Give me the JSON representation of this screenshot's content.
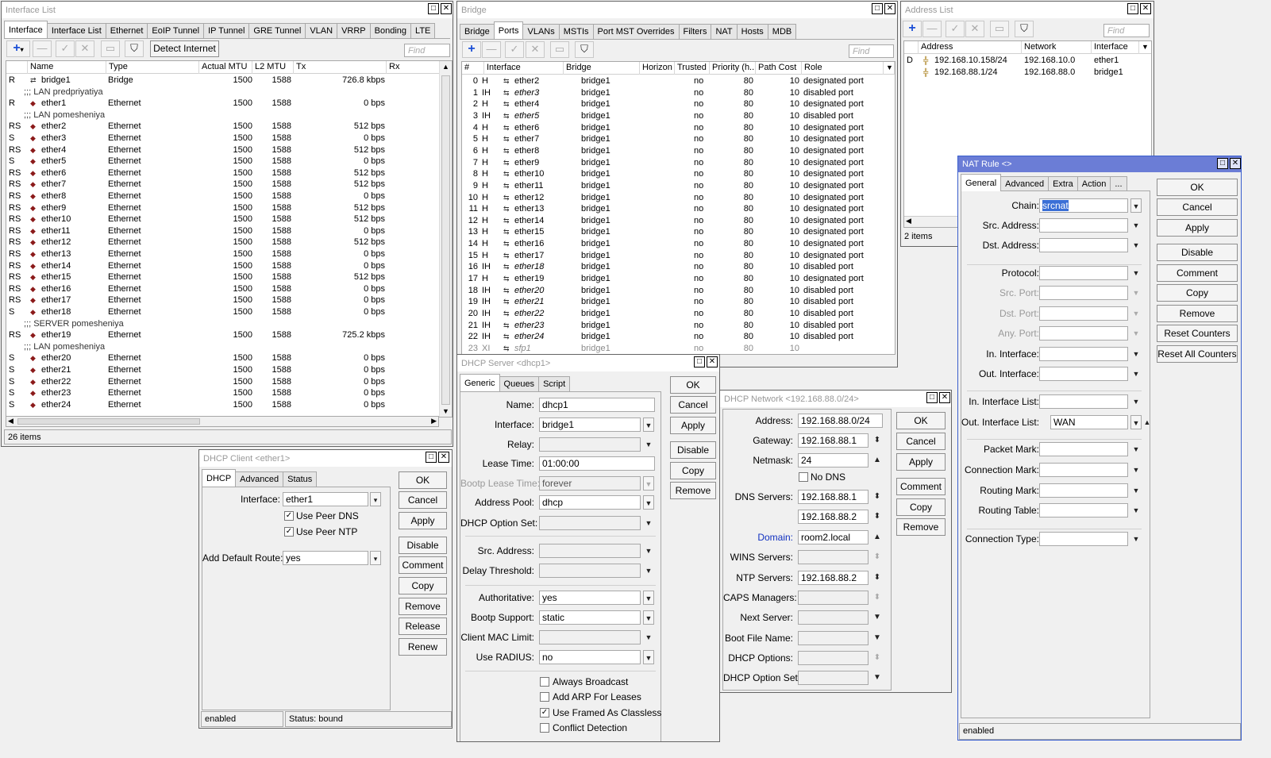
{
  "iface": {
    "title": "Interface List",
    "tabs": [
      "Interface",
      "Interface List",
      "Ethernet",
      "EoIP Tunnel",
      "IP Tunnel",
      "GRE Tunnel",
      "VLAN",
      "VRRP",
      "Bonding",
      "LTE"
    ],
    "detect_btn": "Detect Internet",
    "find": "Find",
    "cols": [
      "Name",
      "Type",
      "Actual MTU",
      "L2 MTU",
      "Tx",
      "Rx"
    ],
    "rows": [
      {
        "f": "R",
        "n": "bridge1",
        "t": "Bridge",
        "mtu": "1500",
        "l2": "1588",
        "tx": "726.8 kbps",
        "bridge": true
      },
      {
        "comment": ";;; LAN predpriyatiya"
      },
      {
        "f": "R",
        "n": "ether1",
        "t": "Ethernet",
        "mtu": "1500",
        "l2": "1588",
        "tx": "0 bps"
      },
      {
        "comment": ";;; LAN pomesheniya"
      },
      {
        "f": "RS",
        "n": "ether2",
        "t": "Ethernet",
        "mtu": "1500",
        "l2": "1588",
        "tx": "512 bps"
      },
      {
        "f": "S",
        "n": "ether3",
        "t": "Ethernet",
        "mtu": "1500",
        "l2": "1588",
        "tx": "0 bps"
      },
      {
        "f": "RS",
        "n": "ether4",
        "t": "Ethernet",
        "mtu": "1500",
        "l2": "1588",
        "tx": "512 bps"
      },
      {
        "f": "S",
        "n": "ether5",
        "t": "Ethernet",
        "mtu": "1500",
        "l2": "1588",
        "tx": "0 bps"
      },
      {
        "f": "RS",
        "n": "ether6",
        "t": "Ethernet",
        "mtu": "1500",
        "l2": "1588",
        "tx": "512 bps"
      },
      {
        "f": "RS",
        "n": "ether7",
        "t": "Ethernet",
        "mtu": "1500",
        "l2": "1588",
        "tx": "512 bps"
      },
      {
        "f": "RS",
        "n": "ether8",
        "t": "Ethernet",
        "mtu": "1500",
        "l2": "1588",
        "tx": "0 bps"
      },
      {
        "f": "RS",
        "n": "ether9",
        "t": "Ethernet",
        "mtu": "1500",
        "l2": "1588",
        "tx": "512 bps"
      },
      {
        "f": "RS",
        "n": "ether10",
        "t": "Ethernet",
        "mtu": "1500",
        "l2": "1588",
        "tx": "512 bps"
      },
      {
        "f": "RS",
        "n": "ether11",
        "t": "Ethernet",
        "mtu": "1500",
        "l2": "1588",
        "tx": "0 bps"
      },
      {
        "f": "RS",
        "n": "ether12",
        "t": "Ethernet",
        "mtu": "1500",
        "l2": "1588",
        "tx": "512 bps"
      },
      {
        "f": "RS",
        "n": "ether13",
        "t": "Ethernet",
        "mtu": "1500",
        "l2": "1588",
        "tx": "0 bps"
      },
      {
        "f": "RS",
        "n": "ether14",
        "t": "Ethernet",
        "mtu": "1500",
        "l2": "1588",
        "tx": "0 bps"
      },
      {
        "f": "RS",
        "n": "ether15",
        "t": "Ethernet",
        "mtu": "1500",
        "l2": "1588",
        "tx": "512 bps"
      },
      {
        "f": "RS",
        "n": "ether16",
        "t": "Ethernet",
        "mtu": "1500",
        "l2": "1588",
        "tx": "0 bps"
      },
      {
        "f": "RS",
        "n": "ether17",
        "t": "Ethernet",
        "mtu": "1500",
        "l2": "1588",
        "tx": "0 bps"
      },
      {
        "f": "S",
        "n": "ether18",
        "t": "Ethernet",
        "mtu": "1500",
        "l2": "1588",
        "tx": "0 bps"
      },
      {
        "comment": ";;; SERVER pomesheniya"
      },
      {
        "f": "RS",
        "n": "ether19",
        "t": "Ethernet",
        "mtu": "1500",
        "l2": "1588",
        "tx": "725.2 kbps"
      },
      {
        "comment": ";;; LAN pomesheniya"
      },
      {
        "f": "S",
        "n": "ether20",
        "t": "Ethernet",
        "mtu": "1500",
        "l2": "1588",
        "tx": "0 bps"
      },
      {
        "f": "S",
        "n": "ether21",
        "t": "Ethernet",
        "mtu": "1500",
        "l2": "1588",
        "tx": "0 bps"
      },
      {
        "f": "S",
        "n": "ether22",
        "t": "Ethernet",
        "mtu": "1500",
        "l2": "1588",
        "tx": "0 bps"
      },
      {
        "f": "S",
        "n": "ether23",
        "t": "Ethernet",
        "mtu": "1500",
        "l2": "1588",
        "tx": "0 bps"
      },
      {
        "f": "S",
        "n": "ether24",
        "t": "Ethernet",
        "mtu": "1500",
        "l2": "1588",
        "tx": "0 bps"
      }
    ],
    "count": "26 items"
  },
  "bridge": {
    "title": "Bridge",
    "tabs": [
      "Bridge",
      "Ports",
      "VLANs",
      "MSTIs",
      "Port MST Overrides",
      "Filters",
      "NAT",
      "Hosts",
      "MDB"
    ],
    "find": "Find",
    "cols": [
      "#",
      "Interface",
      "Bridge",
      "Horizon",
      "Trusted",
      "Priority (h...",
      "Path Cost",
      "Role"
    ],
    "rows": [
      {
        "n": "0",
        "f": "H",
        "i": "ether2",
        "b": "bridge1",
        "tr": "no",
        "p": "80",
        "pc": "10",
        "r": "designated port"
      },
      {
        "n": "1",
        "f": "IH",
        "i": "ether3",
        "b": "bridge1",
        "tr": "no",
        "p": "80",
        "pc": "10",
        "r": "disabled port"
      },
      {
        "n": "2",
        "f": "H",
        "i": "ether4",
        "b": "bridge1",
        "tr": "no",
        "p": "80",
        "pc": "10",
        "r": "designated port"
      },
      {
        "n": "3",
        "f": "IH",
        "i": "ether5",
        "b": "bridge1",
        "tr": "no",
        "p": "80",
        "pc": "10",
        "r": "disabled port"
      },
      {
        "n": "4",
        "f": "H",
        "i": "ether6",
        "b": "bridge1",
        "tr": "no",
        "p": "80",
        "pc": "10",
        "r": "designated port"
      },
      {
        "n": "5",
        "f": "H",
        "i": "ether7",
        "b": "bridge1",
        "tr": "no",
        "p": "80",
        "pc": "10",
        "r": "designated port"
      },
      {
        "n": "6",
        "f": "H",
        "i": "ether8",
        "b": "bridge1",
        "tr": "no",
        "p": "80",
        "pc": "10",
        "r": "designated port"
      },
      {
        "n": "7",
        "f": "H",
        "i": "ether9",
        "b": "bridge1",
        "tr": "no",
        "p": "80",
        "pc": "10",
        "r": "designated port"
      },
      {
        "n": "8",
        "f": "H",
        "i": "ether10",
        "b": "bridge1",
        "tr": "no",
        "p": "80",
        "pc": "10",
        "r": "designated port"
      },
      {
        "n": "9",
        "f": "H",
        "i": "ether11",
        "b": "bridge1",
        "tr": "no",
        "p": "80",
        "pc": "10",
        "r": "designated port"
      },
      {
        "n": "10",
        "f": "H",
        "i": "ether12",
        "b": "bridge1",
        "tr": "no",
        "p": "80",
        "pc": "10",
        "r": "designated port"
      },
      {
        "n": "11",
        "f": "H",
        "i": "ether13",
        "b": "bridge1",
        "tr": "no",
        "p": "80",
        "pc": "10",
        "r": "designated port"
      },
      {
        "n": "12",
        "f": "H",
        "i": "ether14",
        "b": "bridge1",
        "tr": "no",
        "p": "80",
        "pc": "10",
        "r": "designated port"
      },
      {
        "n": "13",
        "f": "H",
        "i": "ether15",
        "b": "bridge1",
        "tr": "no",
        "p": "80",
        "pc": "10",
        "r": "designated port"
      },
      {
        "n": "14",
        "f": "H",
        "i": "ether16",
        "b": "bridge1",
        "tr": "no",
        "p": "80",
        "pc": "10",
        "r": "designated port"
      },
      {
        "n": "15",
        "f": "H",
        "i": "ether17",
        "b": "bridge1",
        "tr": "no",
        "p": "80",
        "pc": "10",
        "r": "designated port"
      },
      {
        "n": "16",
        "f": "IH",
        "i": "ether18",
        "b": "bridge1",
        "tr": "no",
        "p": "80",
        "pc": "10",
        "r": "disabled port"
      },
      {
        "n": "17",
        "f": "H",
        "i": "ether19",
        "b": "bridge1",
        "tr": "no",
        "p": "80",
        "pc": "10",
        "r": "designated port"
      },
      {
        "n": "18",
        "f": "IH",
        "i": "ether20",
        "b": "bridge1",
        "tr": "no",
        "p": "80",
        "pc": "10",
        "r": "disabled port"
      },
      {
        "n": "19",
        "f": "IH",
        "i": "ether21",
        "b": "bridge1",
        "tr": "no",
        "p": "80",
        "pc": "10",
        "r": "disabled port"
      },
      {
        "n": "20",
        "f": "IH",
        "i": "ether22",
        "b": "bridge1",
        "tr": "no",
        "p": "80",
        "pc": "10",
        "r": "disabled port"
      },
      {
        "n": "21",
        "f": "IH",
        "i": "ether23",
        "b": "bridge1",
        "tr": "no",
        "p": "80",
        "pc": "10",
        "r": "disabled port"
      },
      {
        "n": "22",
        "f": "IH",
        "i": "ether24",
        "b": "bridge1",
        "tr": "no",
        "p": "80",
        "pc": "10",
        "r": "disabled port"
      },
      {
        "n": "23",
        "f": "XI",
        "i": "sfp1",
        "b": "bridge1",
        "tr": "no",
        "p": "80",
        "pc": "10",
        "r": ""
      }
    ]
  },
  "addr": {
    "title": "Address List",
    "find": "Find",
    "cols": [
      "Address",
      "Network",
      "Interface"
    ],
    "rows": [
      {
        "f": "D",
        "a": "192.168.10.158/24",
        "n": "192.168.10.0",
        "i": "ether1"
      },
      {
        "f": "",
        "a": "192.168.88.1/24",
        "n": "192.168.88.0",
        "i": "bridge1"
      }
    ],
    "count": "2 items"
  },
  "nat": {
    "title": "NAT Rule <>",
    "tabs": [
      "General",
      "Advanced",
      "Extra",
      "Action",
      "..."
    ],
    "labels": {
      "chain": "Chain:",
      "src_addr": "Src. Address:",
      "dst_addr": "Dst. Address:",
      "protocol": "Protocol:",
      "src_port": "Src. Port:",
      "dst_port": "Dst. Port:",
      "any_port": "Any. Port:",
      "in_if": "In. Interface:",
      "out_if": "Out. Interface:",
      "in_list": "In. Interface List:",
      "out_list": "Out. Interface List:",
      "packet_mark": "Packet Mark:",
      "conn_mark": "Connection Mark:",
      "routing_mark": "Routing Mark:",
      "routing_table": "Routing Table:",
      "conn_type": "Connection Type:"
    },
    "chain": "srcnat",
    "out_list": "WAN",
    "buttons": [
      "OK",
      "Cancel",
      "Apply",
      "Disable",
      "Comment",
      "Copy",
      "Remove",
      "Reset Counters",
      "Reset All Counters"
    ],
    "status": "enabled"
  },
  "dhcpc": {
    "title": "DHCP Client <ether1>",
    "tabs": [
      "DHCP",
      "Advanced",
      "Status"
    ],
    "interface_label": "Interface:",
    "interface": "ether1",
    "peer_dns": "Use Peer DNS",
    "peer_ntp": "Use Peer NTP",
    "route_label": "Add Default Route:",
    "route": "yes",
    "buttons": [
      "OK",
      "Cancel",
      "Apply",
      "Disable",
      "Comment",
      "Copy",
      "Remove",
      "Release",
      "Renew"
    ],
    "status_left": "enabled",
    "status_right": "Status: bound"
  },
  "dhcps": {
    "title": "DHCP Server <dhcp1>",
    "tabs": [
      "Generic",
      "Queues",
      "Script"
    ],
    "labels": {
      "name": "Name:",
      "iface": "Interface:",
      "relay": "Relay:",
      "lease": "Lease Time:",
      "bootp_lease": "Bootp Lease Time:",
      "pool": "Address Pool:",
      "optset": "DHCP Option Set:",
      "src": "Src. Address:",
      "delay": "Delay Threshold:",
      "auth": "Authoritative:",
      "bootp_support": "Bootp Support:",
      "mac_limit": "Client MAC Limit:",
      "radius": "Use RADIUS:"
    },
    "name": "dhcp1",
    "iface": "bridge1",
    "lease": "01:00:00",
    "bootp_lease": "forever",
    "pool": "dhcp",
    "auth": "yes",
    "bootp_support": "static",
    "radius": "no",
    "checks": [
      "Always Broadcast",
      "Add ARP For Leases",
      "Use Framed As Classless",
      "Conflict Detection"
    ],
    "buttons": [
      "OK",
      "Cancel",
      "Apply",
      "Disable",
      "Copy",
      "Remove"
    ]
  },
  "dhcpn": {
    "title": "DHCP Network <192.168.88.0/24>",
    "labels": {
      "address": "Address:",
      "gateway": "Gateway:",
      "netmask": "Netmask:",
      "dns": "DNS Servers:",
      "domain": "Domain:",
      "wins": "WINS Servers:",
      "ntp": "NTP Servers:",
      "caps": "CAPS Managers:",
      "next": "Next Server:",
      "boot": "Boot File Name:",
      "options": "DHCP Options:",
      "optset": "DHCP Option Set:"
    },
    "address": "192.168.88.0/24",
    "gateway": "192.168.88.1",
    "netmask": "24",
    "no_dns": "No DNS",
    "dns1": "192.168.88.1",
    "dns2": "192.168.88.2",
    "domain": "room2.local",
    "ntp": "192.168.88.2",
    "buttons": [
      "OK",
      "Cancel",
      "Apply",
      "Comment",
      "Copy",
      "Remove"
    ]
  }
}
